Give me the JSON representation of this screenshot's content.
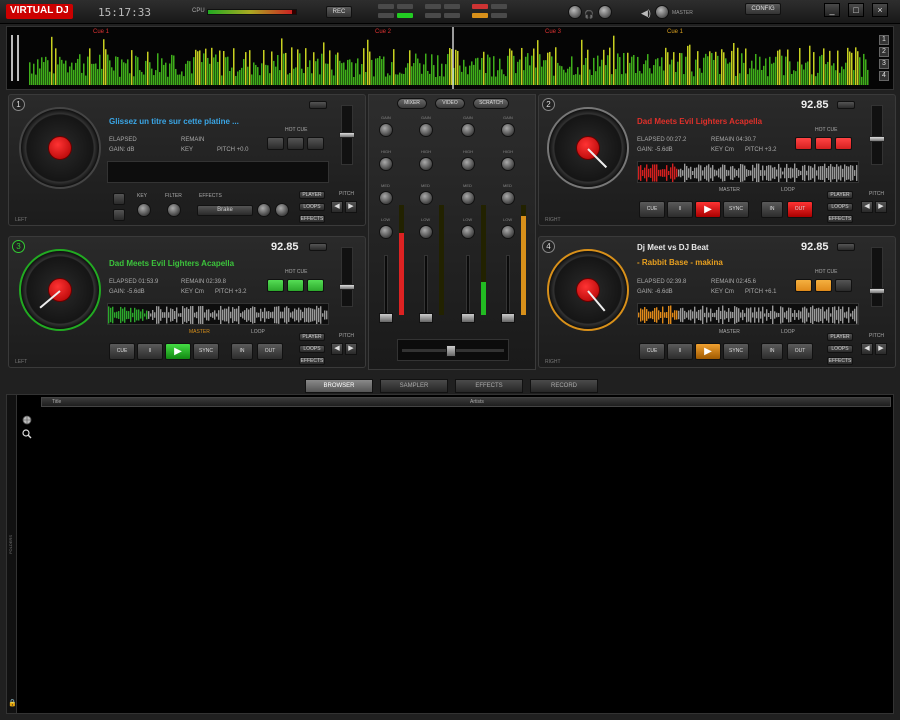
{
  "app": {
    "logo": "VIRTUAL DJ",
    "clock": "15:17:33",
    "cpu_label": "CPU",
    "cpu_load": 0.95,
    "rec_button": "REC",
    "config_button": "CONFIG",
    "master_label": "MASTER",
    "window_controls": [
      "_",
      "□",
      "×"
    ]
  },
  "overview": {
    "cue_markers": [
      "Cue 1",
      "Cue 2",
      "Cue 3",
      "Cue 1"
    ],
    "side_buttons": [
      "1",
      "2",
      "3",
      "4"
    ]
  },
  "decks": [
    {
      "number": "1",
      "side": "LEFT",
      "title": "Glissez un titre sur cette platine ...",
      "subtitle": "",
      "bpm": "",
      "elapsed": "ELAPSED",
      "remain": "REMAIN",
      "gain": "GAIN: dB",
      "key": "KEY",
      "pitch": "PITCH +0.0",
      "hot_cue_label": "HOT CUE",
      "title_color": "#3aa6e6",
      "accent": "#888888",
      "effects_label": "EFFECTS",
      "effect_value": "Brake",
      "key_label": "KEY",
      "filter_label": "FILTER"
    },
    {
      "number": "2",
      "side": "RIGHT",
      "title": "Dad Meets Evil Lighters Acapella",
      "subtitle": "",
      "bpm": "92.85",
      "elapsed": "ELAPSED 00:27.2",
      "remain": "REMAIN 04:30.7",
      "gain": "GAIN: -5.6dB",
      "key": "KEY Cm",
      "pitch": "PITCH +3.2",
      "hot_cue_label": "HOT CUE",
      "title_color": "#e0302a",
      "accent": "#d42020",
      "master_label": "MASTER",
      "loop_label": "LOOP"
    },
    {
      "number": "3",
      "side": "LEFT",
      "title": "Dad Meets Evil Lighters Acapella",
      "subtitle": "",
      "bpm": "92.85",
      "elapsed": "ELAPSED 01:53.9",
      "remain": "REMAIN 02:39.8",
      "gain": "GAIN: -5.6dB",
      "key": "KEY Cm",
      "pitch": "PITCH +3.2",
      "hot_cue_label": "HOT CUE",
      "title_color": "#3cc43c",
      "accent": "#2ca82c",
      "master_label": "MASTER",
      "loop_label": "LOOP"
    },
    {
      "number": "4",
      "side": "RIGHT",
      "title": "Dj Meet vs DJ Beat",
      "subtitle": "- Rabbit Base - makina",
      "bpm": "92.85",
      "elapsed": "ELAPSED 02:39.8",
      "remain": "REMAIN 02:45.6",
      "gain": "GAIN: -6.6dB",
      "key": "KEY Cm",
      "pitch": "PITCH +6.1",
      "hot_cue_label": "HOT CUE",
      "title_color": "#e8e8e8",
      "subtitle_color": "#e8a020",
      "accent": "#e08a1a",
      "master_label": "MASTER",
      "loop_label": "LOOP"
    }
  ],
  "transport": {
    "cue": "CUE",
    "pause": "II",
    "play": "▶",
    "sync": "SYNC",
    "loop_in": "IN",
    "loop_out": "OUT"
  },
  "side_buttons": {
    "player": "PLAYER",
    "loops": "LOOPS",
    "effects": "EFFECTS",
    "pitch": "PITCH"
  },
  "mixer": {
    "tabs": [
      "MIXER",
      "VIDEO",
      "SCRATCH"
    ],
    "knob_labels": [
      "GAIN",
      "HIGH",
      "MED",
      "LOW"
    ]
  },
  "bottom_tabs": [
    "BROWSER",
    "SAMPLER",
    "EFFECTS",
    "RECORD"
  ],
  "browser": {
    "columns": [
      "Title",
      "Artists"
    ],
    "folders_label": "FOLDERS"
  }
}
